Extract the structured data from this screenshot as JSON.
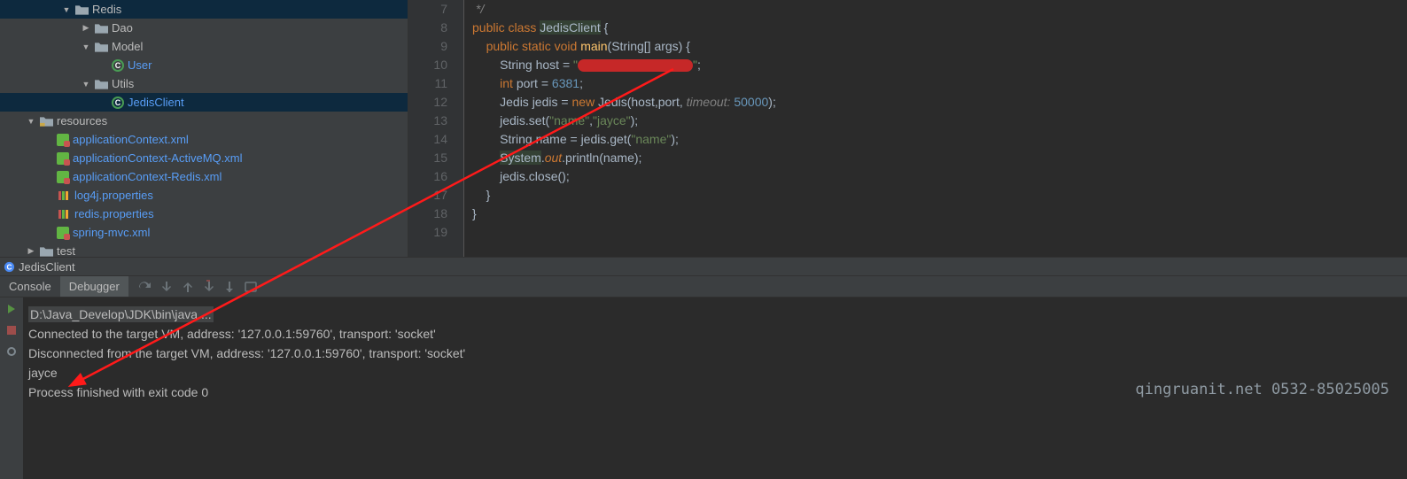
{
  "tree": {
    "redis": "Redis",
    "dao": "Dao",
    "model": "Model",
    "user": "User",
    "utils": "Utils",
    "jedisclient": "JedisClient",
    "resources": "resources",
    "appctx": "applicationContext.xml",
    "appctx_mq": "applicationContext-ActiveMQ.xml",
    "appctx_redis": "applicationContext-Redis.xml",
    "log4j": "log4j.properties",
    "redisprop": "redis.properties",
    "springmvc": "spring-mvc.xml",
    "test": "test"
  },
  "editor": {
    "lines": [
      "7",
      "8",
      "9",
      "10",
      "11",
      "12",
      "13",
      "14",
      "15",
      "16",
      "17",
      "18",
      "19"
    ]
  },
  "code": {
    "l7": " */",
    "l8_1": "public ",
    "l8_2": "class ",
    "l8_3": "JedisClient",
    "l8_4": " {",
    "l9_1": "public static ",
    "l9_2": "void ",
    "l9_3": "main",
    "l9_4": "(String[] args) {",
    "l10_1": "String host = ",
    "l10_2": "\"",
    "l10_3": "\"",
    "l10_4": ";",
    "l11_1": "int ",
    "l11_2": "port = ",
    "l11_3": "6381",
    "l11_4": ";",
    "l12_1": "Jedis jedis = ",
    "l12_2": "new ",
    "l12_3": "Jedis(host,port, ",
    "l12_4": "timeout: ",
    "l12_5": "50000",
    "l12_6": ");",
    "l13_1": "jedis.set(",
    "l13_2": "\"name\"",
    "l13_3": ",",
    "l13_4": "\"jayce\"",
    "l13_5": ");",
    "l14_1": "String name = jedis.get(",
    "l14_2": "\"name\"",
    "l14_3": ");",
    "l15_1": "System.",
    "l15_2": "out",
    "l15_3": ".println(name);",
    "l16": "jedis.close();",
    "l17": "}",
    "l18": "}"
  },
  "tabstrip": {
    "label": "JedisClient"
  },
  "dbg": {
    "console": "Console",
    "debugger": "Debugger"
  },
  "console": {
    "cmd": "D:\\Java_Develop\\JDK\\bin\\java ...",
    "l2": "Connected to the target VM, address: '127.0.0.1:59760', transport: 'socket'",
    "l3": "Disconnected from the target VM, address: '127.0.0.1:59760', transport: 'socket'",
    "l4": "jayce",
    "l5": "",
    "l6": "Process finished with exit code 0"
  },
  "watermark": "qingruanit.net 0532-85025005"
}
